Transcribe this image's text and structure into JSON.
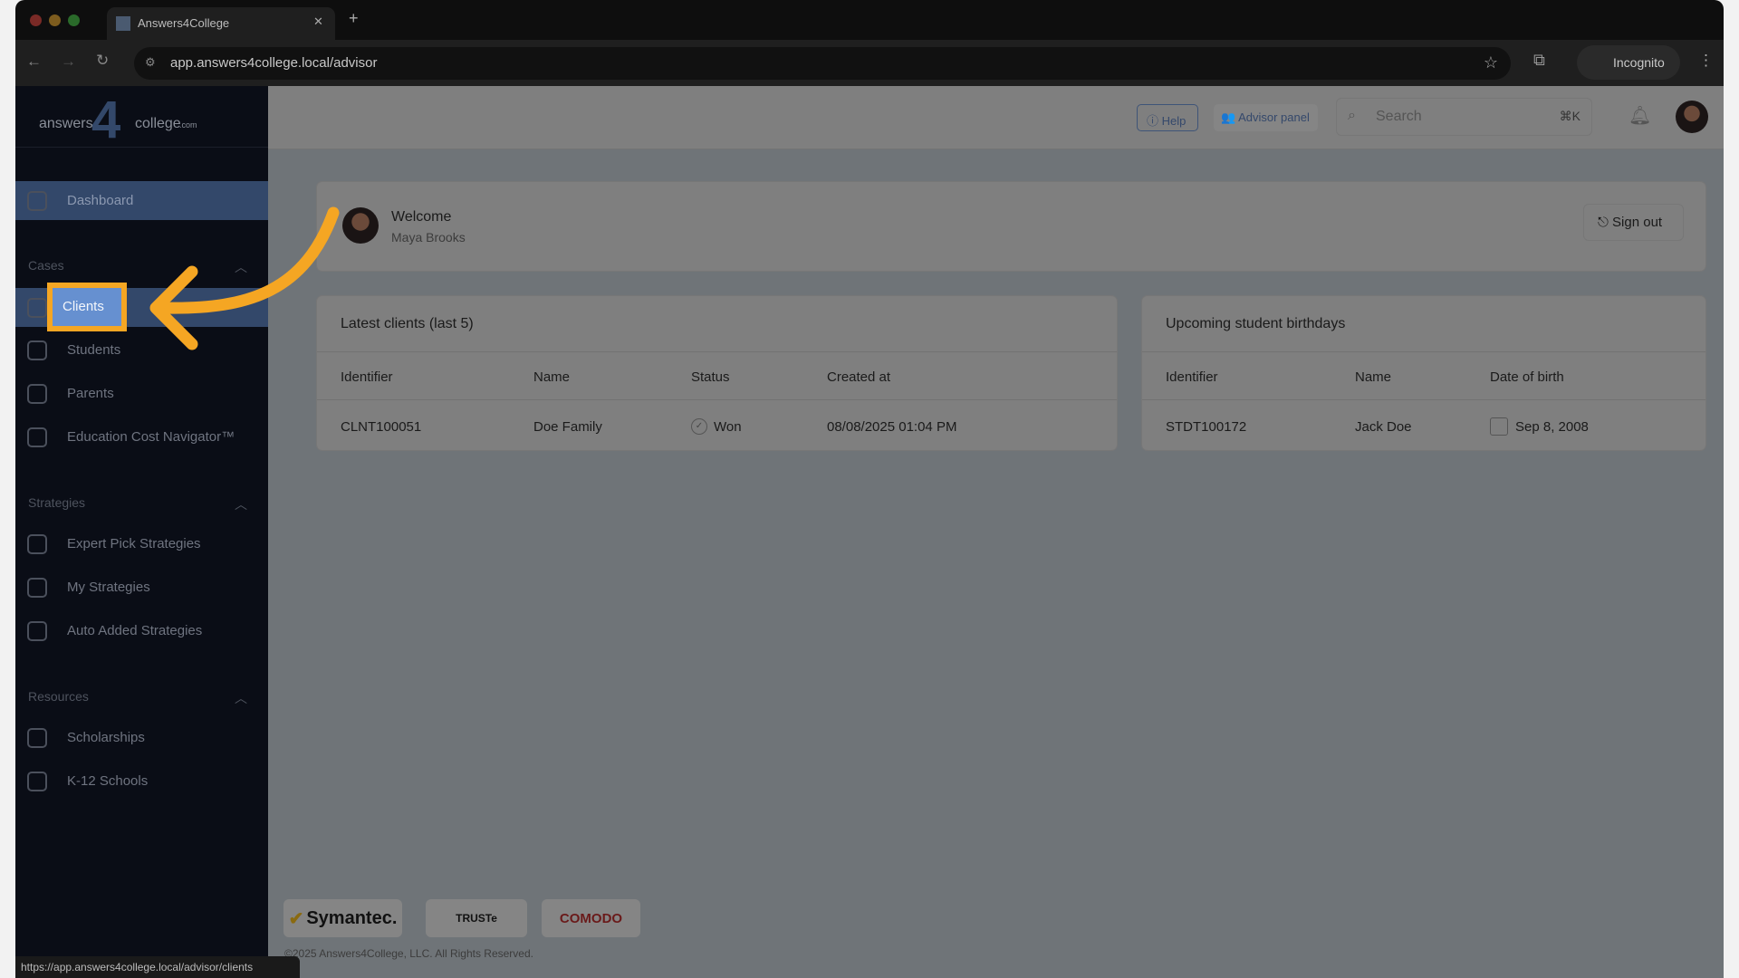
{
  "browser": {
    "tab_title": "Answers4College",
    "url": "app.answers4college.local/advisor",
    "profile": "Incognito",
    "status_url": "https://app.answers4college.local/advisor/clients"
  },
  "logo": {
    "left": "answers",
    "mid": "4",
    "right": "college",
    "suffix": ".com"
  },
  "sidebar": {
    "dashboard": "Dashboard",
    "sections": [
      {
        "title": "Cases",
        "items": [
          "Clients",
          "Students",
          "Parents",
          "Education Cost Navigator™"
        ]
      },
      {
        "title": "Strategies",
        "items": [
          "Expert Pick Strategies",
          "My Strategies",
          "Auto Added Strategies"
        ]
      },
      {
        "title": "Resources",
        "items": [
          "Scholarships",
          "K-12 Schools"
        ]
      }
    ]
  },
  "header": {
    "help": "Help",
    "advisor_panel": "Advisor panel",
    "search_placeholder": "Search",
    "shortcut": "⌘K"
  },
  "welcome": {
    "title": "Welcome",
    "name": "Maya Brooks",
    "sign_out": "Sign out"
  },
  "latest_clients": {
    "title": "Latest clients (last 5)",
    "columns": [
      "Identifier",
      "Name",
      "Status",
      "Created at"
    ],
    "rows": [
      [
        "CLNT100051",
        "Doe Family",
        "Won",
        "08/08/2025 01:04 PM"
      ]
    ]
  },
  "birthdays": {
    "title": "Upcoming student birthdays",
    "columns": [
      "Identifier",
      "Name",
      "Date of birth"
    ],
    "rows": [
      [
        "STDT100172",
        "Jack Doe",
        "Sep 8, 2008"
      ]
    ]
  },
  "footer": {
    "badges": [
      "Symantec.",
      "TRUSTe",
      "COMODO"
    ],
    "copyright": "©2025 Answers4College, LLC. All Rights Reserved."
  },
  "colors": {
    "highlight": "#f5a623",
    "active_nav": "#33486a",
    "clients_chip": "#6690d0"
  }
}
